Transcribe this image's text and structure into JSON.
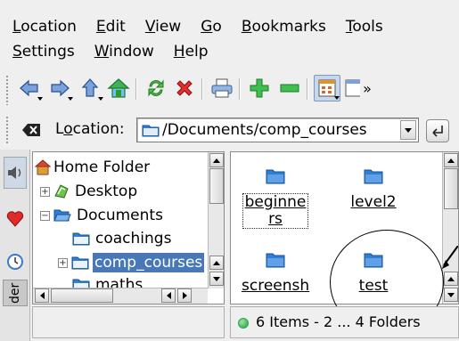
{
  "menubar": {
    "row1": [
      {
        "label": "Location",
        "accel": "L"
      },
      {
        "label": "Edit",
        "accel": "E"
      },
      {
        "label": "View",
        "accel": "V"
      },
      {
        "label": "Go",
        "accel": "G"
      },
      {
        "label": "Bookmarks",
        "accel": "B"
      },
      {
        "label": "Tools",
        "accel": "T"
      }
    ],
    "row2": [
      {
        "label": "Settings",
        "accel": "S"
      },
      {
        "label": "Window",
        "accel": "W"
      },
      {
        "label": "Help",
        "accel": "H"
      }
    ]
  },
  "toolbar": {
    "icons": [
      "back-icon",
      "forward-icon",
      "up-icon",
      "home-icon",
      "reload-icon",
      "stop-icon",
      "print-icon",
      "zoom-in-icon",
      "zoom-out-icon",
      "icon-view-icon",
      "split-view-icon"
    ],
    "overflow": "»"
  },
  "location": {
    "label": "Location:",
    "label_accel": "o",
    "path": "/Documents/comp_courses"
  },
  "sidebar_tabs": [
    "speaker-icon",
    "bookmark-heart-icon",
    "history-icon"
  ],
  "sidebar_tab_text": "der",
  "tree": {
    "items": [
      {
        "label": "Home Folder",
        "expander": "",
        "depth": 0
      },
      {
        "label": "Desktop",
        "expander": "+",
        "depth": 1
      },
      {
        "label": "Documents",
        "expander": "−",
        "depth": 1
      },
      {
        "label": "coachings",
        "expander": "",
        "depth": 2
      },
      {
        "label": "comp_courses",
        "expander": "+",
        "depth": 2,
        "selected": true
      },
      {
        "label": "maths",
        "expander": "",
        "depth": 2
      }
    ]
  },
  "files": [
    {
      "label_line1": "beginne",
      "label_line2": "rs",
      "focused": true
    },
    {
      "label_line1": "level2",
      "label_line2": ""
    },
    {
      "label_line1": "screensh",
      "label_line2": ""
    },
    {
      "label_line1": "test",
      "label_line2": ""
    }
  ],
  "status": {
    "text": "6 Items - 2 ... 4 Folders"
  },
  "colors": {
    "selection": "#4978b6",
    "folder_blue": "#2f7fd6",
    "background": "#efefef"
  }
}
